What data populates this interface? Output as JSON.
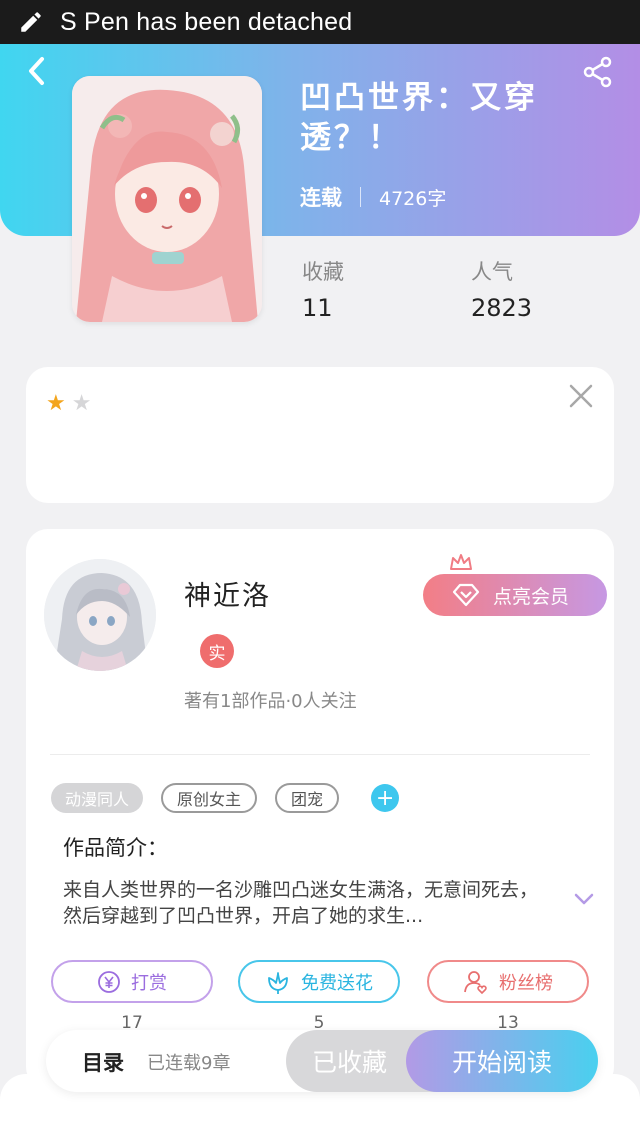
{
  "status_bar": {
    "message": "S Pen has been detached",
    "icon": "pen-icon"
  },
  "header": {
    "title": "凹凸世界：又穿透？！",
    "serial_status": "连载",
    "word_count": "4726字",
    "back_icon": "back-chevron-icon",
    "share_icon": "share-icon",
    "gradient": [
      "#40d6f0",
      "#b38ee6"
    ]
  },
  "stats": {
    "favorites": {
      "label": "收藏",
      "value": "11"
    },
    "popularity": {
      "label": "人气",
      "value": "2823"
    }
  },
  "rating": {
    "stars_filled": 1,
    "stars_total": 2,
    "star_color": "#f3a51e"
  },
  "author": {
    "name": "神近洛",
    "badge": "实",
    "meta": "著有1部作品·0人关注",
    "vip_button": "点亮会员"
  },
  "tags": [
    {
      "label": "动漫同人",
      "style": "filled"
    },
    {
      "label": "原创女主",
      "style": "outline"
    },
    {
      "label": "团宠",
      "style": "outline"
    }
  ],
  "intro": {
    "title": "作品简介：",
    "text": "来自人类世界的一名沙雕凹凸迷女生满洛，无意间死去，然后穿越到了凹凸世界，开启了她的求生..."
  },
  "actions": [
    {
      "label": "打赏",
      "count": "17",
      "icon": "yen-coin-icon"
    },
    {
      "label": "免费送花",
      "count": "5",
      "icon": "flower-icon"
    },
    {
      "label": "粉丝榜",
      "count": "13",
      "icon": "fans-user-icon"
    }
  ],
  "bottom_bar": {
    "toc": "目录",
    "chapters": "已连载9章",
    "collected": "已收藏",
    "start_reading": "开始阅读"
  }
}
